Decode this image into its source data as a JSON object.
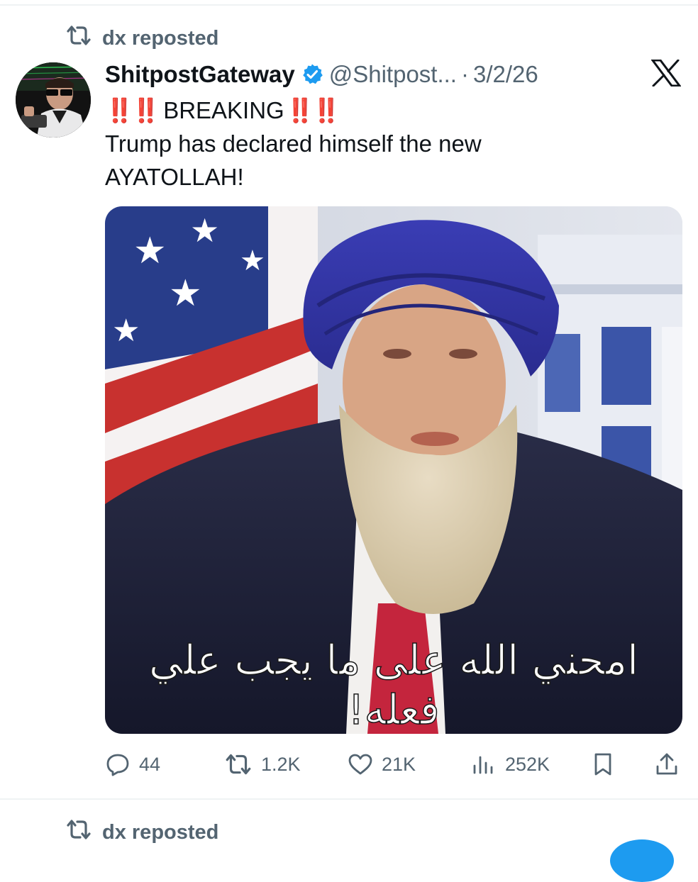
{
  "repost_header": {
    "text": "dx reposted"
  },
  "tweet": {
    "display_name": "ShitpostGateway",
    "handle": "@Shitpost...",
    "date": "3/2/26",
    "text_prefix_marks": "‼️‼️",
    "text_breaking": "BREAKING",
    "text_suffix_marks": "‼️‼️",
    "text_line2": "Trump has declared himself the new",
    "text_line3": "AYATOLLAH!",
    "media_caption_line1": "امحني الله على ما يجب علي",
    "media_caption_line2": "فعله!"
  },
  "actions": {
    "replies": "44",
    "reposts": "1.2K",
    "likes": "21K",
    "views": "252K"
  },
  "next_repost_header": {
    "text": "dx reposted"
  },
  "colors": {
    "secondary_text": "#536471",
    "primary_text": "#0f1419",
    "verified_blue": "#1d9bf0",
    "alert_red": "#e0272a",
    "divider": "#eff3f4"
  },
  "icons": [
    "repost-icon",
    "verified-badge-icon",
    "x-logo-icon",
    "reply-icon",
    "like-icon",
    "views-icon",
    "bookmark-icon",
    "share-icon"
  ]
}
